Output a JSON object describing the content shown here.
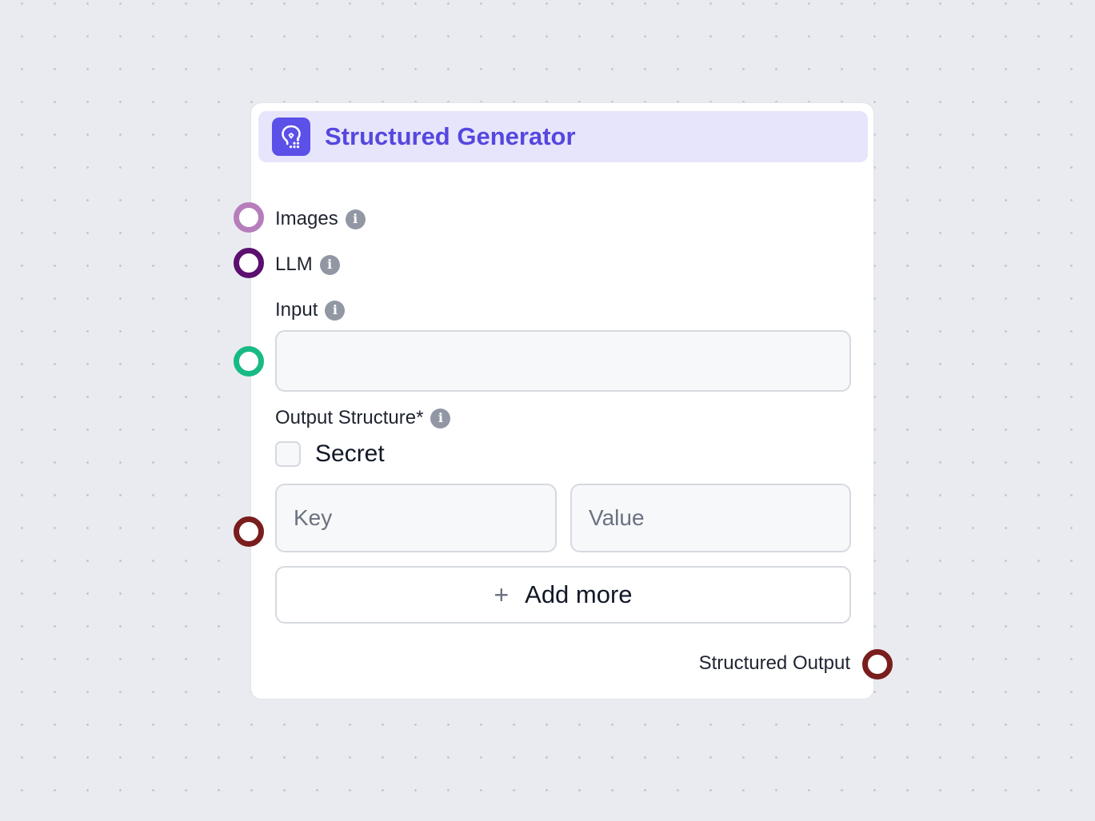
{
  "node": {
    "title": "Structured Generator",
    "icon": "lightbulb-icon",
    "colors": {
      "header_bg": "#e6e5fb",
      "title": "#5547df",
      "icon_bg": "#5b50e8"
    }
  },
  "fields": {
    "images": {
      "label": "Images",
      "handle_color": "#b77dbb"
    },
    "llm": {
      "label": "LLM",
      "handle_color": "#5b0f6e"
    },
    "input": {
      "label": "Input",
      "value": "",
      "placeholder": "",
      "handle_color": "#17ba85"
    },
    "output_structure": {
      "label": "Output Structure*",
      "secret_label": "Secret",
      "secret_checked": false,
      "key_placeholder": "Key",
      "value_placeholder": "Value",
      "add_more_label": "Add more",
      "handle_color": "#7a1d1d"
    }
  },
  "outputs": {
    "structured_output": {
      "label": "Structured Output",
      "handle_color": "#7a1d1d"
    }
  }
}
